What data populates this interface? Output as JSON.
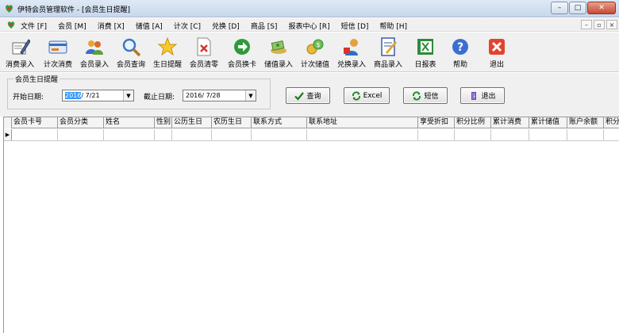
{
  "window": {
    "title": "伊特会员管理软件 - [会员生日提醒]",
    "minimize_glyph": "–",
    "maximize_glyph": "□",
    "close_glyph": "✕"
  },
  "menu": {
    "items": [
      "文件 [F]",
      "会员 [M]",
      "消费 [X]",
      "储值 [A]",
      "计次 [C]",
      "兑换 [D]",
      "商品 [S]",
      "报表中心 [R]",
      "短信 [D]",
      "帮助 [H]"
    ],
    "mdi_glyphs": [
      "–",
      "▫",
      "×"
    ]
  },
  "toolbar": {
    "buttons": [
      {
        "label": "消费录入",
        "icon": "pen-receipt-icon"
      },
      {
        "label": "计次消费",
        "icon": "card-icon"
      },
      {
        "label": "会员录入",
        "icon": "users-icon"
      },
      {
        "label": "会员查询",
        "icon": "magnifier-icon"
      },
      {
        "label": "生日提醒",
        "icon": "star-icon"
      },
      {
        "label": "会员清零",
        "icon": "clear-doc-icon"
      },
      {
        "label": "会员换卡",
        "icon": "arrow-right-icon"
      },
      {
        "label": "储值录入",
        "icon": "money-icon"
      },
      {
        "label": "计次储值",
        "icon": "coins-icon"
      },
      {
        "label": "兑换录入",
        "icon": "gift-icon"
      },
      {
        "label": "商品录入",
        "icon": "notebook-icon"
      },
      {
        "label": "日报表",
        "icon": "excel-icon"
      },
      {
        "label": "帮助",
        "icon": "help-icon"
      },
      {
        "label": "退出",
        "icon": "exit-icon"
      }
    ]
  },
  "filter": {
    "group_title": "会员生日提醒",
    "start_label": "开始日期:",
    "start_year": "2016",
    "start_rest": "/ 7/21",
    "end_label": "截止日期:",
    "end_value": "2016/ 7/28",
    "dropdown_glyph": "▼"
  },
  "actions": {
    "query": "查询",
    "excel": "Excel",
    "sms": "短信",
    "exit": "退出"
  },
  "grid": {
    "columns": [
      "会员卡号",
      "会员分类",
      "姓名",
      "性别",
      "公历生日",
      "农历生日",
      "联系方式",
      "联系地址",
      "享受折扣",
      "积分比例",
      "累计消费",
      "累计储值",
      "账户余额",
      "积分"
    ],
    "current_row_marker": "▶"
  },
  "colors": {
    "accent": "#3399ff",
    "titlebar": "#c7d7ec",
    "chrome": "#f0f0f0"
  }
}
